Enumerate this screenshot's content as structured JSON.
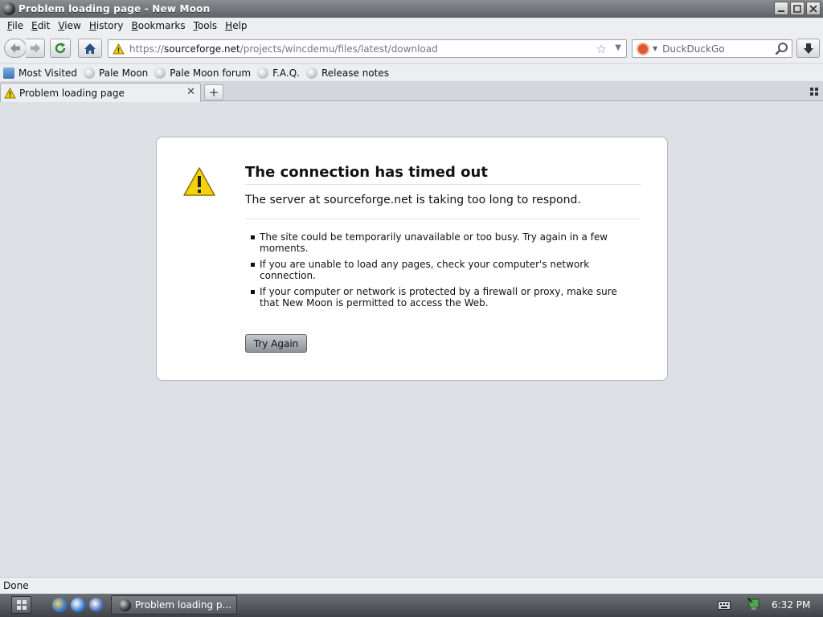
{
  "window": {
    "title": "Problem loading page - New Moon"
  },
  "menu": {
    "items": [
      "File",
      "Edit",
      "View",
      "History",
      "Bookmarks",
      "Tools",
      "Help"
    ]
  },
  "navbar": {
    "url_scheme": "https://",
    "url_host": "sourceforge.net",
    "url_path": "/projects/wincdemu/files/latest/download",
    "search_engine": "DuckDuckGo"
  },
  "bookmarks": {
    "items": [
      "Most Visited",
      "Pale Moon",
      "Pale Moon forum",
      "F.A.Q.",
      "Release notes"
    ]
  },
  "tab": {
    "title": "Problem loading page"
  },
  "error": {
    "title": "The connection has timed out",
    "description": "The server at sourceforge.net is taking too long to respond.",
    "bullets": [
      "The site could be temporarily unavailable or too busy. Try again in a few moments.",
      "If you are unable to load any pages, check your computer's network connection.",
      "If your computer or network is protected by a firewall or proxy, make sure that New Moon is permitted to access the Web."
    ],
    "button_label": "Try Again"
  },
  "status": {
    "text": "Done"
  },
  "taskbar": {
    "task_label": "Problem loading p...",
    "clock": "6:32 PM"
  },
  "colors": {
    "content_bg": "#dde0e4",
    "titlebar": "#6f7277",
    "warning_yellow": "#f5d20b"
  }
}
